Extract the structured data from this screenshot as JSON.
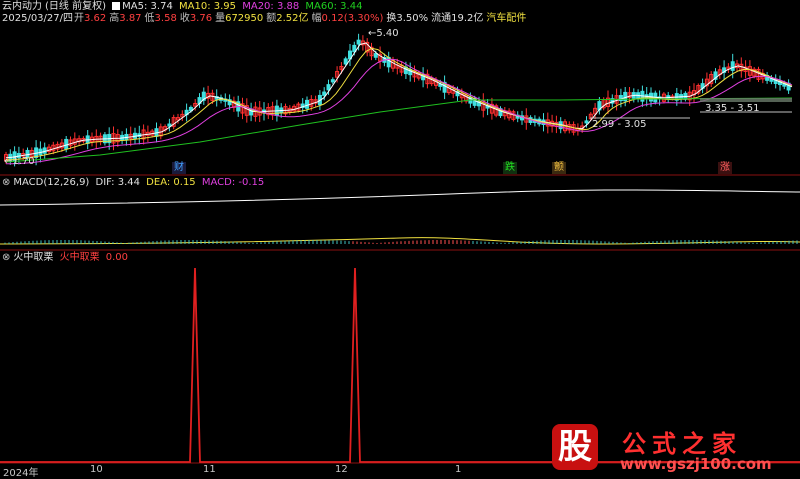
{
  "header": {
    "app": "云内动力",
    "mode": "(日线 前复权)",
    "ma5": "MA5: 3.74",
    "ma10": "MA10: 3.95",
    "ma20": "MA20: 3.88",
    "ma60": "MA60: 3.44"
  },
  "info": {
    "date": "2025/03/27/四",
    "open_l": "开",
    "open": "3.62",
    "high_l": "高",
    "high": "3.87",
    "low_l": "低",
    "low": "3.58",
    "close_l": "收",
    "close": "3.76",
    "vol_l": "量",
    "vol": "672950",
    "amt_l": "额",
    "amt": "2.52亿",
    "chg_l": "幅",
    "chg": "0.12(3.30%)",
    "turn": "换3.50%",
    "float": "流通19.2亿",
    "sector": "汽车配件"
  },
  "price_labels": {
    "peak": "5.40",
    "low_left": "1.70",
    "range1": "2.99 - 3.05",
    "range2": "3.35 - 3.51"
  },
  "markers": {
    "m1": "财",
    "m2": "跌",
    "m3": "颤",
    "m4": "涨"
  },
  "macd": {
    "name": "MACD(12,26,9)",
    "dif": "DIF: 3.44",
    "dea": "DEA: 0.15",
    "macd": "MACD: -0.15"
  },
  "indicator": {
    "name": "火中取栗",
    "label": "火中取栗",
    "value": "0.00"
  },
  "xaxis": {
    "year": "2024年",
    "t10": "10",
    "t11": "11",
    "t12": "12",
    "t1": "1"
  },
  "watermark": {
    "logo": "股",
    "title": "公式之家",
    "url": "www.gszj100.com"
  },
  "colors": {
    "up": "#ff3030",
    "down": "#40e0e0",
    "ma5": "#ffffff",
    "ma10": "#f0e040",
    "ma20": "#e040e0",
    "ma60": "#20c020",
    "signal": "#e02020"
  }
}
